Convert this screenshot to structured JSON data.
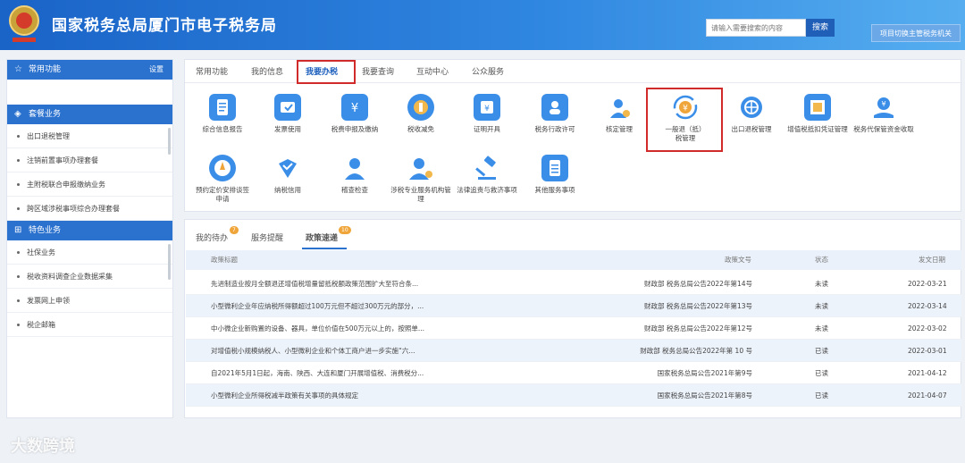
{
  "header": {
    "title": "国家税务总局厦门市电子税务局",
    "search_placeholder": "请输入需要搜索的内容",
    "search_label": "搜索",
    "switch_label": "项目切换主管税务机关"
  },
  "sidebar": {
    "common_title": "常用功能",
    "settings_label": "设置",
    "package_title": "套餐业务",
    "package_items": [
      "出口退税管理",
      "注销前置事项办理套餐",
      "主附税联合申报缴纳业务",
      "跨区域涉税事项综合办理套餐"
    ],
    "special_title": "特色业务",
    "special_items": [
      "社保业务",
      "税收资料调查企业数据采集",
      "发票网上申领",
      "税企邮箱"
    ]
  },
  "tabs": [
    "常用功能",
    "我的信息",
    "我要办税",
    "我要查询",
    "互动中心",
    "公众服务"
  ],
  "services": [
    {
      "label": "综合信息报告",
      "icon": "report-icon",
      "color": "#3b8ee8"
    },
    {
      "label": "发票使用",
      "icon": "invoice-icon",
      "color": "#3b8ee8"
    },
    {
      "label": "税费申报及缴纳",
      "icon": "tax-declare-icon",
      "color": "#3b8ee8"
    },
    {
      "label": "税收减免",
      "icon": "tax-relief-icon",
      "color": "#3b8ee8"
    },
    {
      "label": "证明开具",
      "icon": "certificate-icon",
      "color": "#3b8ee8"
    },
    {
      "label": "税务行政许可",
      "icon": "license-icon",
      "color": "#3b8ee8"
    },
    {
      "label": "核定管理",
      "icon": "verify-icon",
      "color": "#3b8ee8"
    },
    {
      "label": "一般退（抵）税管理",
      "icon": "refund-icon",
      "color": "#f0a53a"
    },
    {
      "label": "出口退税管理",
      "icon": "export-refund-icon",
      "color": "#3b8ee8"
    },
    {
      "label": "增值税抵扣凭证管理",
      "icon": "voucher-icon",
      "color": "#3b8ee8"
    },
    {
      "label": "税务代保管资金收取",
      "icon": "custody-icon",
      "color": "#3b8ee8"
    },
    {
      "label": "预约定价安排谈签申请",
      "icon": "compass-icon",
      "color": "#3b8ee8"
    },
    {
      "label": "纳税信用",
      "icon": "credit-icon",
      "color": "#3b8ee8"
    },
    {
      "label": "稽查检查",
      "icon": "inspection-icon",
      "color": "#3b8ee8"
    },
    {
      "label": "涉税专业服务机构管理",
      "icon": "agency-icon",
      "color": "#3b8ee8"
    },
    {
      "label": "法律追责与救济事项",
      "icon": "gavel-icon",
      "color": "#3b8ee8"
    },
    {
      "label": "其他服务事项",
      "icon": "other-icon",
      "color": "#3b8ee8"
    }
  ],
  "bottom_tabs": {
    "todo": "我的待办",
    "todo_count": "7",
    "reminder": "服务提醒",
    "policy": "政策速递",
    "policy_count": "10"
  },
  "policy_table": {
    "headers": [
      "政策标题",
      "政策文号",
      "状态",
      "发文日期"
    ],
    "rows": [
      {
        "title": "先进制造业按月全额退还增值税增量留抵税额政策范围扩大至符合条...",
        "doc": "财政部 税务总局公告2022年第14号",
        "status": "未读",
        "date": "2022-03-21"
      },
      {
        "title": "小型微利企业年应纳税所得额超过100万元但不超过300万元的部分，...",
        "doc": "财政部 税务总局公告2022年第13号",
        "status": "未读",
        "date": "2022-03-14"
      },
      {
        "title": "中小微企业新购置的设备、器具，单位价值在500万元以上的，按照单...",
        "doc": "财政部 税务总局公告2022年第12号",
        "status": "未读",
        "date": "2022-03-02"
      },
      {
        "title": "对增值税小规模纳税人、小型微利企业和个体工商户进一步实施“六...",
        "doc": "财政部 税务总局公告2022年第 10 号",
        "status": "已读",
        "date": "2022-03-01"
      },
      {
        "title": "自2021年5月1日起，海南、陕西、大连和厦门开展增值税、消费税分...",
        "doc": "国家税务总局公告2021年第9号",
        "status": "已读",
        "date": "2021-04-12"
      },
      {
        "title": "小型微利企业所得税减半政策有关事项的具体规定",
        "doc": "国家税务总局公告2021年第8号",
        "status": "已读",
        "date": "2021-04-07"
      }
    ]
  },
  "watermark": "大数跨境"
}
